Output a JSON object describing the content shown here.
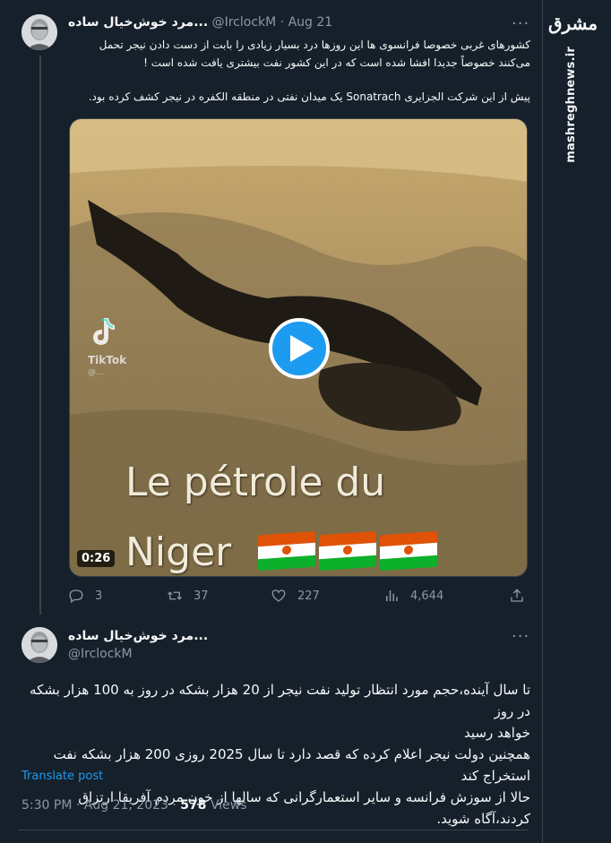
{
  "tweet1": {
    "display_name": "مرد خوش‌خیال ساده...",
    "handle": "@IrclockM",
    "separator": "·",
    "date": "Aug 21",
    "text_line1": "کشورهای غربی خصوصا فرانسوی ها این روزها  درد بسیار زیادی را بابت از دست دادن نیجر تحمل",
    "text_line2": "می‌کنند خصوصاً جدیدا افشا شده است که در این کشور نفت بیشتری یافت شده است !",
    "text_line3": "پیش از این شرکت الجزایری Sonatrach یک میدان نفتی در منطقه الکفره در نیجر کشف کرده بود.",
    "media": {
      "title_line1": "Le pétrole du",
      "title_line2": "Niger",
      "duration": "0:26",
      "watermark_app": "TikTok",
      "watermark_user": "@..."
    },
    "stats": {
      "replies": "3",
      "retweets": "37",
      "likes": "227",
      "views": "4,644"
    }
  },
  "tweet2": {
    "display_name": "مرد خوش‌خیال ساده...",
    "handle": "@IrclockM",
    "text_line1": "تا سال آینده،حجم مورد انتظار تولید نفت نیجر از 20 هزار بشکه در روز به 100 هزار بشکه در روز",
    "text_line2": "خواهد رسید",
    "text_line3": "همچنین دولت نیجر اعلام کرده که قصد دارد تا سال 2025 روزی 200 هزار بشکه نفت استخراج کند",
    "text_line4": "حالا از سوزش فرانسه و سایر استعمارگرانی که سالها از خون مردم آفریقا ارتزاق کردند،آگاه شوید.",
    "translate_label": "Translate post",
    "time": "5:30 PM",
    "date": "Aug 21, 2023",
    "views_count": "578",
    "views_label": "Views"
  },
  "watermark": {
    "logo": "مشرق",
    "site": "mashreghnews.ir"
  },
  "colors": {
    "background": "#15202b",
    "text": "#f7f9f9",
    "secondary": "#8b98a5",
    "accent": "#1d9bf0",
    "border": "#38444d"
  }
}
